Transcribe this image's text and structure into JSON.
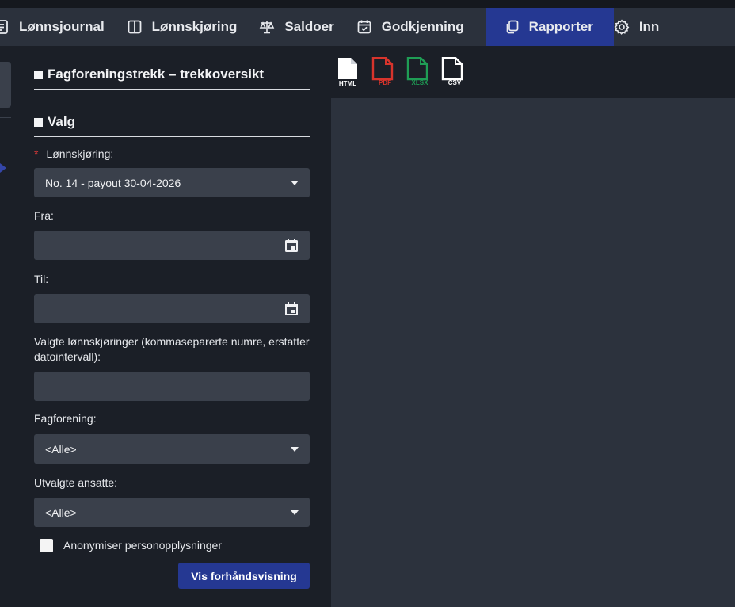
{
  "nav": {
    "items": [
      {
        "label": "Lønnsjournal",
        "icon": "document-list-icon"
      },
      {
        "label": "Lønnskjøring",
        "icon": "columns-icon"
      },
      {
        "label": "Saldoer",
        "icon": "scale-icon"
      },
      {
        "label": "Godkjenning",
        "icon": "calendar-check-icon"
      },
      {
        "label": "Rapporter",
        "icon": "copy-icon",
        "active": true
      },
      {
        "label": "Inn",
        "icon": "gear-icon"
      }
    ],
    "active_color": "#253892"
  },
  "panel": {
    "title": "Fagforeningstrekk – trekkoversikt",
    "section": "Valg",
    "required_marker": "*",
    "payroll_run": {
      "label": "Lønnskjøring:",
      "value": "No. 14 - payout 30-04-2026"
    },
    "from": {
      "label": "Fra:",
      "value": ""
    },
    "to": {
      "label": "Til:",
      "value": ""
    },
    "selected_runs": {
      "label": "Valgte lønnskjøringer (kommaseparerte numre, erstatter datointervall):",
      "value": ""
    },
    "union": {
      "label": "Fagforening:",
      "value": "<Alle>"
    },
    "employees": {
      "label": "Utvalgte ansatte:",
      "value": "<Alle>"
    },
    "anonymize": {
      "label": "Anonymiser personopplysninger",
      "checked": false
    },
    "preview_button": "Vis forhåndsvisning"
  },
  "exports": [
    {
      "format": "HTML",
      "color": "#ffffff"
    },
    {
      "format": "PDF",
      "color": "#d8342c"
    },
    {
      "format": "XLSX",
      "color": "#1f9d55"
    },
    {
      "format": "CSV",
      "color": "#ffffff"
    }
  ]
}
